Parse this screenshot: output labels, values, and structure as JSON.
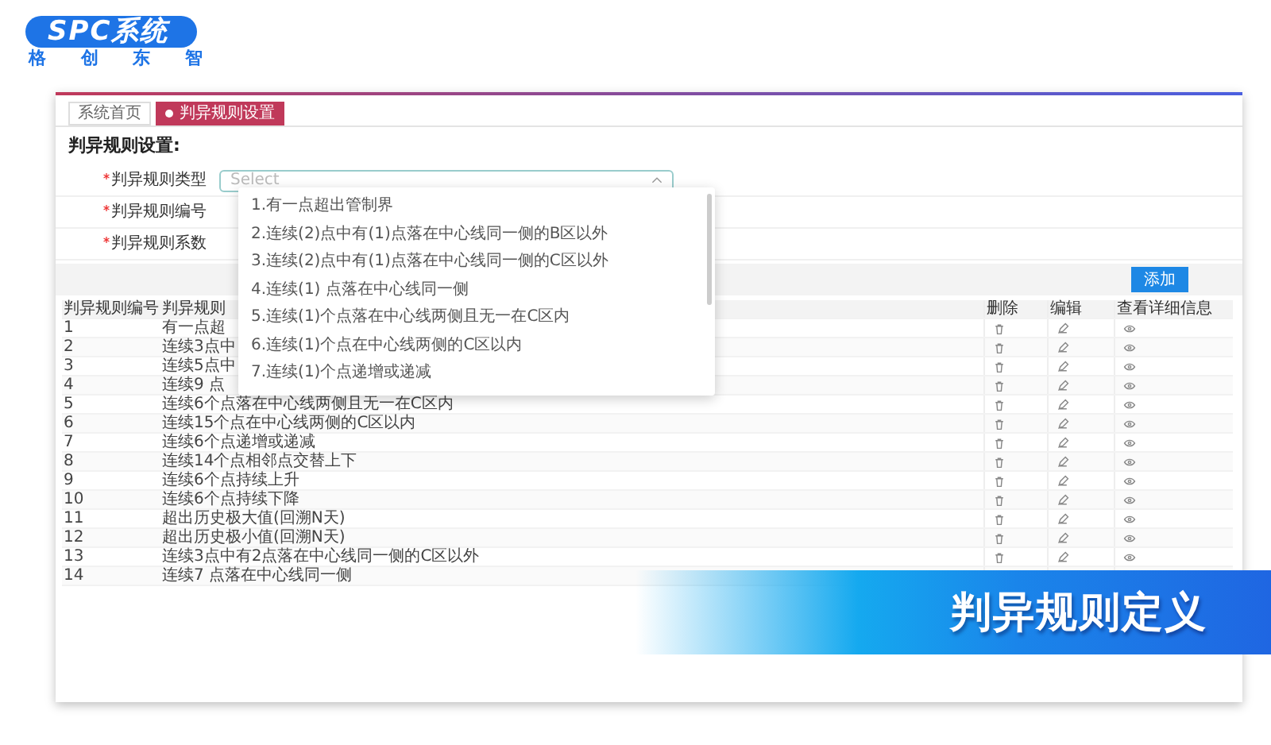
{
  "brand": {
    "logo": "SPC系统",
    "tagline": "格 创 东 智"
  },
  "tabs": [
    {
      "label": "系统首页",
      "selected": false
    },
    {
      "label": "判异规则设置",
      "selected": true
    }
  ],
  "heading": "判异规则设置:",
  "form": [
    {
      "label": "判异规则类型",
      "required": true,
      "placeholder": "Select"
    },
    {
      "label": "判异规则编号",
      "required": true
    },
    {
      "label": "判异规则系数",
      "required": true
    }
  ],
  "add_button": "添加",
  "table": {
    "columns": [
      "判异规则编号",
      "判异规则",
      "删除",
      "编辑",
      "查看详细信息"
    ],
    "rows": [
      {
        "number": "1",
        "description": "有一点超",
        "actions": true
      },
      {
        "number": "2",
        "description": "连续3点中",
        "actions": true
      },
      {
        "number": "3",
        "description": "连续5点中",
        "actions": true
      },
      {
        "number": "4",
        "description": "连续9 点",
        "actions": true
      },
      {
        "number": "5",
        "description": "连续6个点落在中心线两侧且无一在C区内",
        "actions": true
      },
      {
        "number": "6",
        "description": "连续15个点在中心线两侧的C区以内",
        "actions": true
      },
      {
        "number": "7",
        "description": "连续6个点递增或递减",
        "actions": true
      },
      {
        "number": "8",
        "description": "连续14个点相邻点交替上下",
        "actions": true
      },
      {
        "number": "9",
        "description": "连续6个点持续上升",
        "actions": true
      },
      {
        "number": "10",
        "description": "连续6个点持续下降",
        "actions": true
      },
      {
        "number": "11",
        "description": "超出历史极大值(回溯N天)",
        "actions": true
      },
      {
        "number": "12",
        "description": "超出历史极小值(回溯N天)",
        "actions": true
      },
      {
        "number": "13",
        "description": "连续3点中有2点落在中心线同一侧的C区以外",
        "actions": true
      },
      {
        "number": "14",
        "description": "连续7 点落在中心线同一侧"
      }
    ]
  },
  "dropdown": [
    "1.有一点超出管制界",
    "2.连续(2)点中有(1)点落在中心线同一侧的B区以外",
    "3.连续(2)点中有(1)点落在中心线同一侧的C区以外",
    "4.连续(1) 点落在中心线同一侧",
    "5.连续(1)个点落在中心线两侧且无一在C区内",
    "6.连续(1)个点在中心线两侧的C区以内",
    "7.连续(1)个点递增或递减"
  ],
  "banner": "判异规则定义"
}
